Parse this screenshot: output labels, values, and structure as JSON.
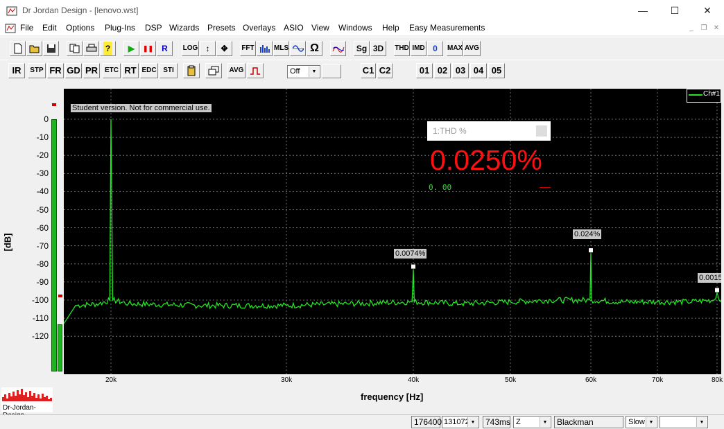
{
  "window": {
    "title": "Dr Jordan Design - [lenovo.wst]",
    "min_glyph": "—",
    "max_glyph": "☐",
    "close_glyph": "✕"
  },
  "menu": [
    "File",
    "Edit",
    "Options",
    "Plug-Ins",
    "DSP",
    "Wizards",
    "Presets",
    "Overlays",
    "ASIO",
    "View",
    "Windows",
    "Help",
    "Easy Measurements"
  ],
  "mdi": {
    "min": "_",
    "restore": "❐",
    "close": "✕"
  },
  "toolbar1": [
    "LOG",
    "FFT",
    "MLS",
    "Sg",
    "3D",
    "THD",
    "IMD",
    "0",
    "MAX",
    "AVG"
  ],
  "toolbar1_play": {
    "play": "▶",
    "pause": "❚❚",
    "record": "R"
  },
  "toolbar2": [
    "IR",
    "STP",
    "FR",
    "GD",
    "PR",
    "ETC",
    "RT",
    "EDC",
    "STI",
    "AVG"
  ],
  "toolbar2_off": "Off",
  "toolbar2_channels": [
    "C1",
    "C2"
  ],
  "toolbar2_overlays": [
    "01",
    "02",
    "03",
    "04",
    "05"
  ],
  "plot": {
    "y_axis_label": "[dB]",
    "x_axis_label": "frequency [Hz]",
    "y_ticks": [
      "0",
      "-10",
      "-20",
      "-30",
      "-40",
      "-50",
      "-60",
      "-70",
      "-80",
      "-90",
      "-100",
      "-110",
      "-120"
    ],
    "x_ticks": [
      "20k",
      "30k",
      "40k",
      "50k",
      "60k",
      "70k",
      "80k"
    ],
    "notice": "Student version. Not for commercial use.",
    "legend": "Ch#1",
    "markers": [
      "0.0074%",
      "0.024%",
      "0.0015"
    ]
  },
  "thd_panel": {
    "title": "1:THD %",
    "value": "0.0250%",
    "sub": "0. 00"
  },
  "logo_text": "Dr-Jordan-Design",
  "status": {
    "sample_rate": "176400",
    "fft_size": "131072",
    "duration": "743ms",
    "weighting": "Z",
    "window": "Blackman",
    "speed": "Slow",
    "extra": ""
  },
  "chart_data": {
    "type": "line",
    "title": "",
    "xlabel": "frequency [Hz]",
    "ylabel": "[dB]",
    "xlim": [
      16000,
      81000
    ],
    "ylim": [
      -135,
      5
    ],
    "series": [
      {
        "name": "Ch#1",
        "x": [
          16000,
          17000,
          19000,
          19900,
          20000,
          20100,
          21000,
          25000,
          30000,
          35000,
          39900,
          40000,
          40100,
          45000,
          50000,
          55000,
          59900,
          60000,
          60100,
          65000,
          70000,
          75000,
          79500,
          80000,
          80500,
          81000
        ],
        "values": [
          -113,
          -103,
          -102,
          -100,
          0,
          -100,
          -102,
          -103,
          -103,
          -102,
          -101,
          -83,
          -101,
          -102,
          -101,
          -100,
          -100,
          -74,
          -100,
          -101,
          -101,
          -101,
          -100,
          -96,
          -100,
          -100
        ]
      }
    ],
    "markers": [
      {
        "x": 40000,
        "label": "0.0074%"
      },
      {
        "x": 60000,
        "label": "0.024%"
      },
      {
        "x": 80000,
        "label": "0.0015"
      }
    ]
  },
  "colors": {
    "trace": "#22e622",
    "thd_value": "#ff1010",
    "plot_bg": "#000000",
    "grid": "#888888"
  }
}
